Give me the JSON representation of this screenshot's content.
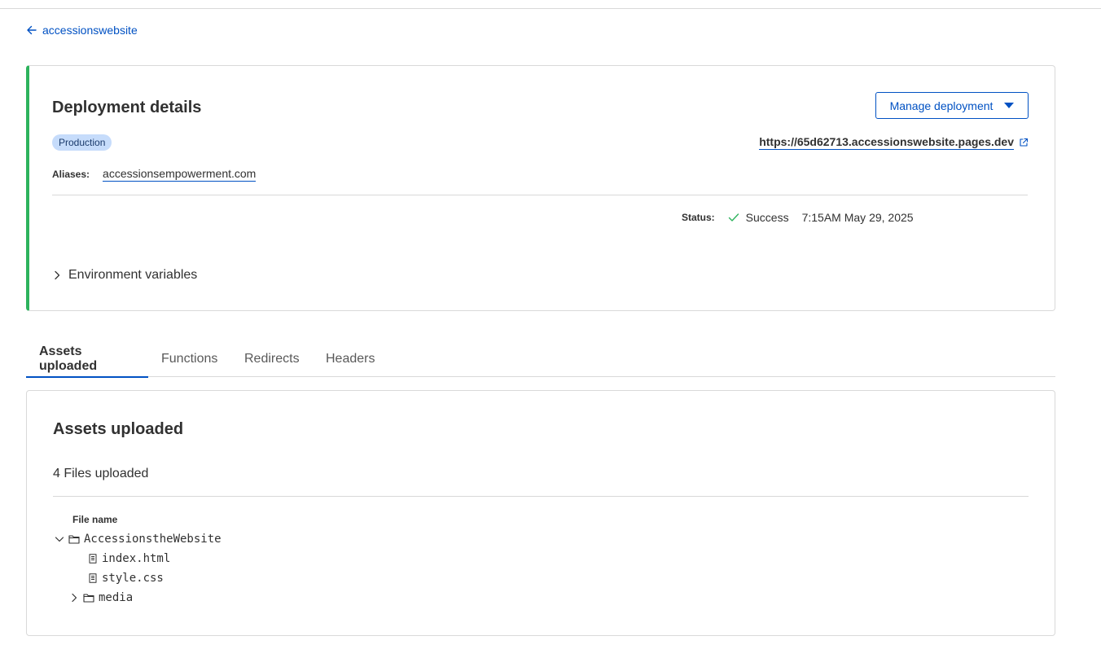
{
  "back_link": {
    "label": "accessionswebsite"
  },
  "deployment": {
    "title": "Deployment details",
    "manage_button": "Manage deployment",
    "environment_badge": "Production",
    "url": "https://65d62713.accessionswebsite.pages.dev",
    "aliases_label": "Aliases:",
    "alias": "accessionsempowerment.com",
    "status_label": "Status:",
    "status": "Success",
    "status_time": "7:15AM May 29, 2025",
    "env_vars_label": "Environment variables"
  },
  "tabs": [
    {
      "label": "Assets uploaded",
      "active": true
    },
    {
      "label": "Functions",
      "active": false
    },
    {
      "label": "Redirects",
      "active": false
    },
    {
      "label": "Headers",
      "active": false
    }
  ],
  "assets": {
    "title": "Assets uploaded",
    "count_text": "4 Files uploaded",
    "column_header": "File name",
    "tree": [
      {
        "name": "AccessionstheWebsite",
        "type": "folder",
        "expanded": true,
        "icon": "folder-icon"
      },
      {
        "name": "index.html",
        "type": "file",
        "icon": "file-icon"
      },
      {
        "name": "style.css",
        "type": "file",
        "icon": "file-icon"
      },
      {
        "name": "media",
        "type": "folder",
        "expanded": false,
        "icon": "folder-icon"
      }
    ]
  },
  "colors": {
    "accent": "#0051c3",
    "success": "#2db35d",
    "badge_bg": "#c6dcfb",
    "border": "#d9d9d9"
  }
}
